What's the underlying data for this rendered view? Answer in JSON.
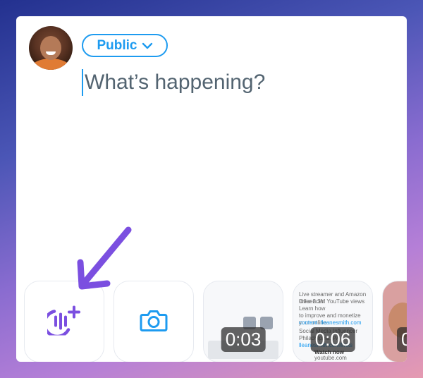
{
  "composer": {
    "audience_label": "Public",
    "placeholder": "What’s happening?"
  },
  "media_row": {
    "tiles": [
      {
        "kind": "add-audio",
        "icon": "add-audio-space-icon"
      },
      {
        "kind": "camera",
        "icon": "camera-icon"
      },
      {
        "kind": "video",
        "duration": "0:03"
      },
      {
        "kind": "video",
        "duration": "0:06",
        "lines": [
          "Live streamer and Amazon Influencer.",
          "Over 2.3M YouTube views",
          "Learn how",
          "to improve and monetize your online",
          "content. lleanesmith.com",
          "Social Media Influencer",
          "Philadelphia, PA",
          "lleanesmith.com/links",
          "Watch now",
          "youtube.com"
        ]
      },
      {
        "kind": "video",
        "duration": "0"
      }
    ]
  },
  "colors": {
    "accent": "#1d9bf0",
    "annotation_arrow": "#7b4fe0",
    "placeholder_text": "#536471"
  }
}
